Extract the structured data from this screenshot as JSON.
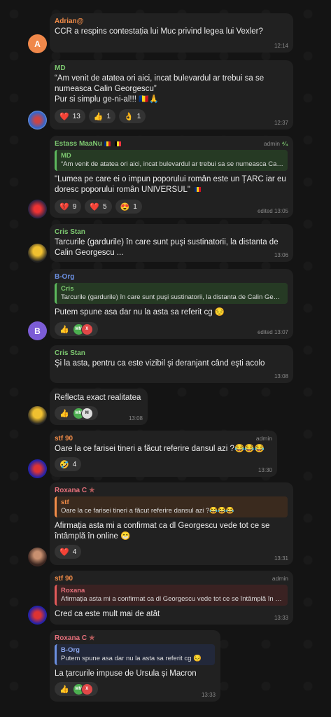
{
  "colors": {
    "background": "#141414",
    "bubble": "#212121",
    "orange_name": "#f28c48",
    "green_name": "#7dc870",
    "blue_name": "#6b8fe0",
    "red_name": "#e25a5a",
    "rose_name": "#e8717c"
  },
  "messages": [
    {
      "sender": "Adrian@",
      "text": "CCR a respins contestația lui Muc privind legea lui Vexler?",
      "time": "12:14",
      "avatar": "A"
    },
    {
      "sender": "MD",
      "text": "“Am venit de atatea ori aici, incat bulevardul ar trebui sa se numeasca Calin Georgescu”\nPur si simplu ge-ni-al!!! 🇷🇴🙏",
      "time": "12:37",
      "reactions": [
        {
          "emoji": "❤️",
          "count": "13"
        },
        {
          "emoji": "👍",
          "count": "1"
        },
        {
          "emoji": "👌",
          "count": "1"
        }
      ]
    },
    {
      "sender": "Estass MaaNu",
      "role": "admin",
      "text": "\"Lumea pe care ei o impun poporului român este un ȚARC iar eu doresc poporului român UNIVERSUL\"",
      "time": "edited 13:05",
      "reply": {
        "name": "MD",
        "text": "“Am venit de atatea ori aici, incat bulevardul ar trebui sa se numeasca Calin Georgescu”"
      },
      "reactions": [
        {
          "emoji": "💔",
          "count": "9"
        },
        {
          "emoji": "❤️",
          "count": "5"
        },
        {
          "emoji": "😍",
          "count": "1"
        }
      ]
    },
    {
      "sender": "Cris Stan",
      "text": "Tarcurile (gardurile) în care sunt puşi sustinatorii, la distanta de Calin Georgescu ...",
      "time": "13:06"
    },
    {
      "sender": "B-Org",
      "text": "Putem spune asa dar nu la asta sa referit cg 😔",
      "time": "edited 13:07",
      "avatar": "B",
      "reply": {
        "name": "Cris",
        "text": "Tarcurile (gardurile) în care sunt puşi sustinatorii, la distanta de Calin Georgescu ..."
      },
      "reactions": [
        {
          "emoji": "👍",
          "count": ""
        }
      ]
    },
    {
      "sender": "Cris Stan",
      "text": "Şi la asta, pentru ca este vizibil şi deranjant când eşti acolo",
      "time": "13:08"
    },
    {
      "text": "Reflecta exact realitatea",
      "time": "13:08",
      "reactions": [
        {
          "emoji": "👍",
          "count": ""
        }
      ]
    },
    {
      "sender": "stf 90",
      "role": "admin",
      "text": "Oare la ce farisei tineri a făcut referire dansul azi ?😂😂😂",
      "time": "13:30",
      "reactions": [
        {
          "emoji": "🤣",
          "count": "4"
        }
      ]
    },
    {
      "sender": "Roxana C",
      "text": "Afirmația asta mi a confirmat ca dl Georgescu vede tot ce se întâmplă în online 😁",
      "time": "13:31",
      "reply": {
        "name": "stf",
        "text": "Oare la ce farisei tineri a făcut referire dansul azi ?😂😂😂"
      },
      "reactions": [
        {
          "emoji": "❤️",
          "count": "4"
        }
      ]
    },
    {
      "sender": "stf 90",
      "role": "admin",
      "text": "Cred ca este mult mai de atât",
      "time": "13:33",
      "reply": {
        "name": "Roxana",
        "text": "Afirmația asta mi a confirmat ca dl Georgescu vede tot ce se întâmplă în online 😁"
      }
    },
    {
      "sender": "Roxana C",
      "text": "La țarcurile impuse de Ursula și Macron",
      "time": "13:33",
      "reply": {
        "name": "B-Org",
        "text": "Putem spune asa dar nu la asta sa referit cg 😔"
      },
      "reactions": [
        {
          "emoji": "👍",
          "count": ""
        }
      ]
    }
  ]
}
